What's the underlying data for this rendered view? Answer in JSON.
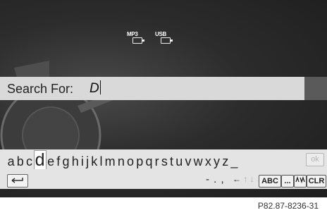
{
  "status_icons": [
    {
      "icon": "mp3-icon",
      "label": "MP3"
    },
    {
      "icon": "usb-icon",
      "label": "USB"
    }
  ],
  "search": {
    "label": "Search For:",
    "value": "D"
  },
  "keyboard": {
    "letters": [
      "a",
      "b",
      "c",
      "d",
      "e",
      "f",
      "g",
      "h",
      "i",
      "j",
      "k",
      "l",
      "m",
      "n",
      "o",
      "p",
      "q",
      "r",
      "s",
      "t",
      "u",
      "v",
      "w",
      "x",
      "y",
      "z",
      "_"
    ],
    "selected_letter": "d",
    "ok_label": "ok",
    "symbols": "- . ,",
    "arrow_left": "←",
    "arrow_up": "↑",
    "arrow_down": "↓",
    "arrow_right": "→",
    "abc_label": "ABC",
    "ellipsis_label": "...",
    "clr_label": "CLR"
  },
  "caption": "P82.87-8236-31"
}
